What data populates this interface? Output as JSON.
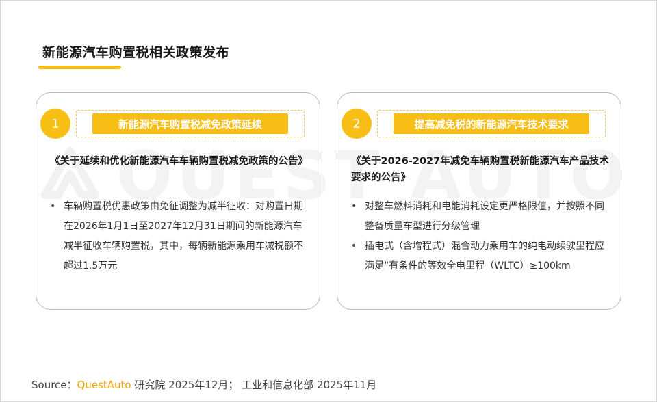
{
  "page": {
    "title": "新能源汽车购置税相关政策发布"
  },
  "watermark": {
    "text": "QUEST AUTO",
    "icon": "quest-auto-logo-icon"
  },
  "cards": [
    {
      "number": "1",
      "banner": "新能源汽车购置税减免政策延续",
      "doc_title": "《关于延续和优化新能源汽车车辆购置税减免政策的公告》",
      "bullets": [
        "车辆购置税优惠政策由免征调整为减半征收：对购置日期在2026年1月1日至2027年12月31日期间的新能源汽车减半征收车辆购置税，其中，每辆新能源乘用车减税额不超过1.5万元"
      ]
    },
    {
      "number": "2",
      "banner": "提高减免税的新能源汽车技术要求",
      "doc_title": "《关于2026-2027年减免车辆购置税新能源汽车产品技术要求的公告》",
      "bullets": [
        "对整车燃料消耗和电能消耗设定更严格限值，并按照不同整备质量车型进行分级管理",
        "插电式（含增程式）混合动力乘用车的纯电动续驶里程应满足“有条件的等效全电里程（WLTC）≥100km"
      ]
    }
  ],
  "source": {
    "label": "Source：",
    "brand": "QuestAuto",
    "rest": " 研究院 2025年12月； 工业和信息化部 2025年11月"
  },
  "colors": {
    "accent": "#f7be16",
    "brand_text": "#f5a400",
    "card_border": "#b9b9b9"
  }
}
